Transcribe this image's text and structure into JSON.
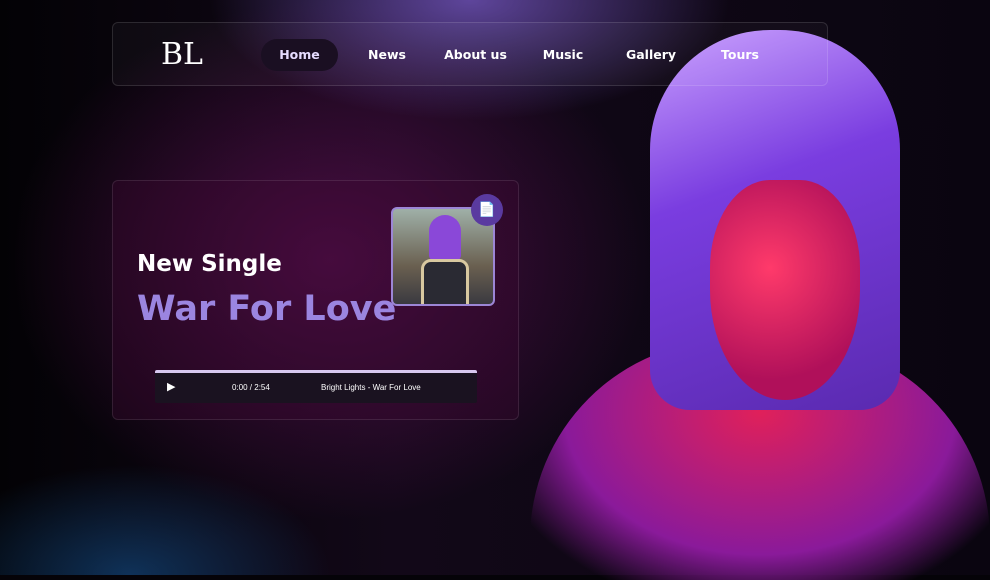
{
  "nav": {
    "logo": "BL",
    "items": [
      {
        "label": "Home",
        "active": true
      },
      {
        "label": "News"
      },
      {
        "label": "About us"
      },
      {
        "label": "Music"
      },
      {
        "label": "Gallery"
      },
      {
        "label": "Tours"
      }
    ]
  },
  "hero": {
    "subtitle": "New Single",
    "title": "War For Love",
    "badge_icon": "document-icon",
    "player": {
      "time": "0:00 / 2:54",
      "track": "Bright Lights - War For Love"
    }
  },
  "colors": {
    "accent": "#9b85e0",
    "badge": "#5a3aa0"
  }
}
